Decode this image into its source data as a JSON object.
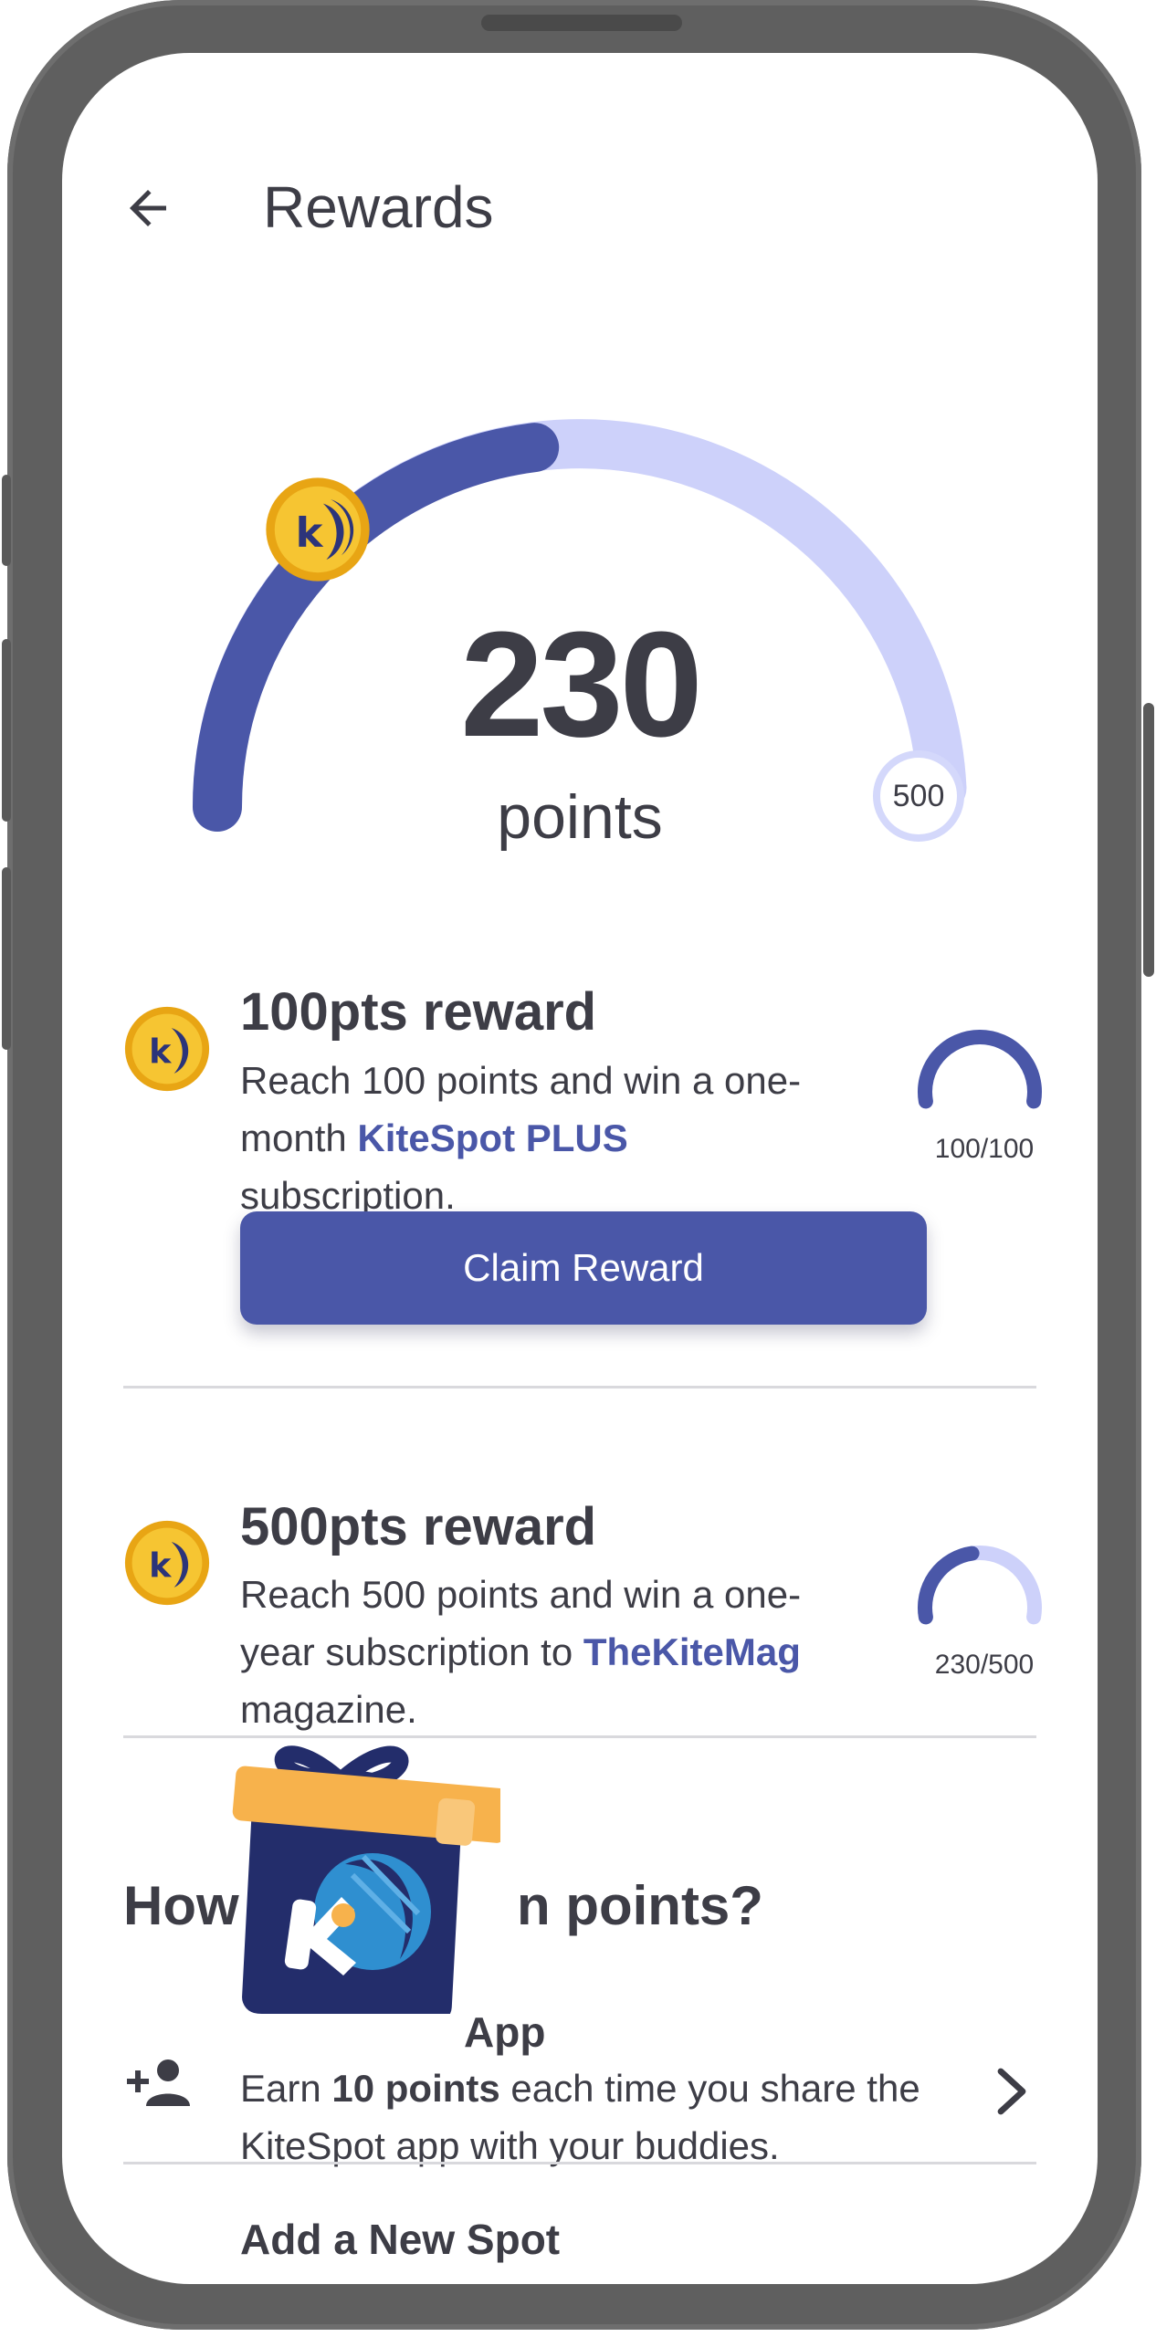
{
  "header": {
    "title": "Rewards"
  },
  "gauge": {
    "points": "230",
    "points_label": "points",
    "max_label": "500",
    "fraction": 0.46,
    "color_fill": "#4a57a8",
    "color_track": "#cdd1fa"
  },
  "rewards": [
    {
      "title": "100pts reward",
      "desc_before": "Reach 100 points and win a one-month ",
      "desc_highlight": "KiteSpot PLUS",
      "desc_after": " subscription.",
      "progress_text": "100/100",
      "fraction": 1.0,
      "button_label": "Claim Reward"
    },
    {
      "title": "500pts reward",
      "desc_before": "Reach 500 points and win a one-year subscription to ",
      "desc_highlight": "TheKiteMag",
      "desc_after": " magazine.",
      "progress_text": "230/500",
      "fraction": 0.46
    }
  ],
  "earn": {
    "section_title_start": "How",
    "section_title_end": "n points?",
    "items": [
      {
        "title_visible": "App",
        "desc_before": "Earn ",
        "desc_bold": "10 points",
        "desc_after": " each time you share the KiteSpot app with your buddies.",
        "icon": "person-add-icon"
      },
      {
        "title": "Add a New Spot",
        "icon": "map-icon"
      }
    ]
  },
  "colors": {
    "accent": "#4a57a8",
    "text": "#3d3d46",
    "gift_orange": "#f7b24c",
    "gift_navy": "#232d6b",
    "coin_gold": "#f2b81d"
  }
}
